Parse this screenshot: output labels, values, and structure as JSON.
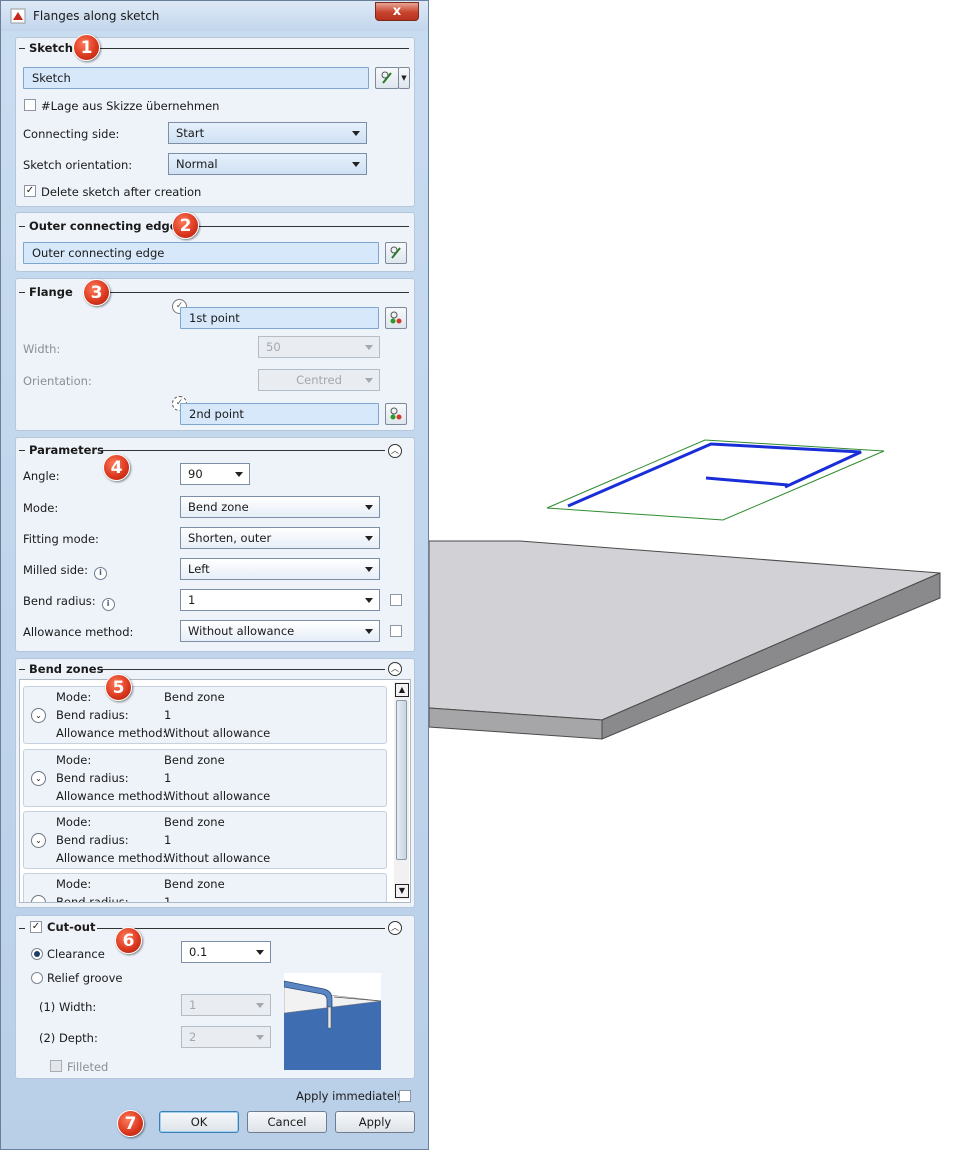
{
  "window": {
    "title": "Flanges along sketch",
    "close_label": "x"
  },
  "badges": [
    "1",
    "2",
    "3",
    "4",
    "5",
    "6",
    "7"
  ],
  "sketch": {
    "header": "Sketch",
    "field_value": "Sketch",
    "lage_label": "#Lage aus Skizze übernehmen",
    "lage_checked": false,
    "connecting_side_label": "Connecting side:",
    "connecting_side_value": "Start",
    "orientation_label": "Sketch orientation:",
    "orientation_value": "Normal",
    "delete_label": "Delete sketch after creation",
    "delete_checked": "✓"
  },
  "outer_edge": {
    "header": "Outer connecting edge",
    "field_value": "Outer connecting edge"
  },
  "flange": {
    "header": "Flange",
    "first_point": "1st point",
    "width_label": "Width:",
    "width_value": "50",
    "orientation_label": "Orientation:",
    "orientation_value": "Centred",
    "second_point": "2nd point"
  },
  "parameters": {
    "header": "Parameters",
    "angle_label": "Angle:",
    "angle_value": "90",
    "mode_label": "Mode:",
    "mode_value": "Bend zone",
    "fitting_label": "Fitting mode:",
    "fitting_value": "Shorten, outer",
    "milled_label": "Milled side:",
    "milled_value": "Left",
    "radius_label": "Bend radius:",
    "radius_value": "1",
    "allowance_label": "Allowance method:",
    "allowance_value": "Without allowance"
  },
  "bend_zones": {
    "header": "Bend zones",
    "items": [
      {
        "mode_k": "Mode:",
        "mode_v": "Bend zone",
        "radius_k": "Bend radius:",
        "radius_v": "1",
        "allow_k": "Allowance method:",
        "allow_v": "Without allowance"
      },
      {
        "mode_k": "Mode:",
        "mode_v": "Bend zone",
        "radius_k": "Bend radius:",
        "radius_v": "1",
        "allow_k": "Allowance method:",
        "allow_v": "Without allowance"
      },
      {
        "mode_k": "Mode:",
        "mode_v": "Bend zone",
        "radius_k": "Bend radius:",
        "radius_v": "1",
        "allow_k": "Allowance method:",
        "allow_v": "Without allowance"
      },
      {
        "mode_k": "Mode:",
        "mode_v": "Bend zone",
        "radius_k": "Bend radius:",
        "radius_v": "1",
        "allow_k": "",
        "allow_v": ""
      }
    ]
  },
  "cutout": {
    "header": "Cut-out",
    "checked": "✓",
    "clearance_label": "Clearance",
    "clearance_value": "0.1",
    "relief_label": "Relief groove",
    "width_label": "(1) Width:",
    "width_value": "1",
    "depth_label": "(2) Depth:",
    "depth_value": "2",
    "filleted_label": "Filleted"
  },
  "footer": {
    "apply_immediately_label": "Apply immediately",
    "ok_label": "OK",
    "cancel_label": "Cancel",
    "apply_label": "Apply"
  },
  "colors": {
    "sketch_line": "#1a2ed8",
    "sketch_frame": "#2e8b2e",
    "plate_top": "#d4d4d8",
    "accent_badge": "#d8351c"
  }
}
